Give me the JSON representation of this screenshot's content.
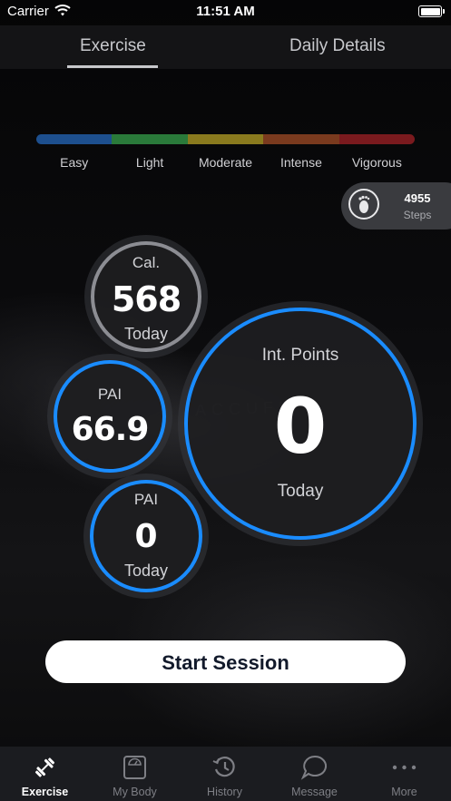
{
  "status_bar": {
    "carrier": "Carrier",
    "time": "11:51 AM"
  },
  "tabs": [
    {
      "label": "Exercise",
      "active": true
    },
    {
      "label": "Daily Details",
      "active": false
    }
  ],
  "intensity": {
    "levels": [
      "Easy",
      "Light",
      "Moderate",
      "Intense",
      "Vigorous"
    ],
    "colors": [
      "#1d4f8e",
      "#2a7a3a",
      "#8a7a1e",
      "#7a3a1e",
      "#7a1a1e"
    ]
  },
  "steps": {
    "count": "4955",
    "label": "Steps",
    "icon": "footprint-icon"
  },
  "metrics": {
    "calories": {
      "title": "Cal.",
      "value": "568",
      "subtitle": "Today"
    },
    "pai_main": {
      "title": "PAI",
      "value": "66.9"
    },
    "pai_today": {
      "title": "PAI",
      "value": "0",
      "subtitle": "Today"
    },
    "int_points": {
      "title": "Int. Points",
      "value": "0",
      "subtitle": "Today"
    }
  },
  "start_session": {
    "label": "Start Session"
  },
  "bottom_nav": [
    {
      "label": "Exercise",
      "icon": "dumbbell-icon",
      "active": true
    },
    {
      "label": "My Body",
      "icon": "scale-icon",
      "active": false
    },
    {
      "label": "History",
      "icon": "history-icon",
      "active": false
    },
    {
      "label": "Message",
      "icon": "chat-bubble-icon",
      "active": false
    },
    {
      "label": "More",
      "icon": "more-dots-icon",
      "active": false
    }
  ],
  "colors": {
    "accent": "#1a8cff",
    "ring_gray": "#8c8d93",
    "button_text": "#121a2b"
  }
}
